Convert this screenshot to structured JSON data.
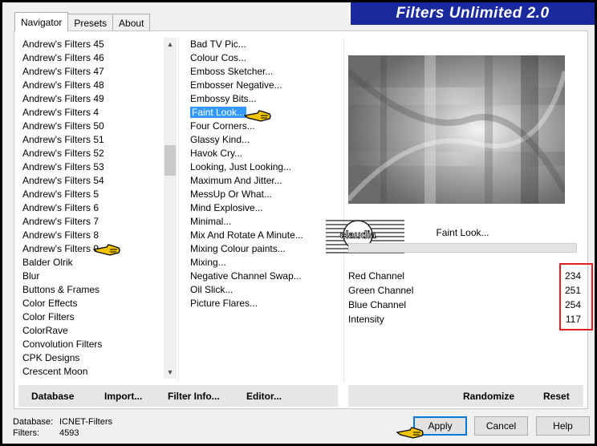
{
  "banner_title": "Filters Unlimited 2.0",
  "tabs": [
    {
      "label": "Navigator",
      "active": true
    },
    {
      "label": "Presets",
      "active": false
    },
    {
      "label": "About",
      "active": false
    }
  ],
  "categories": [
    "Andrew's Filters 45",
    "Andrew's Filters 46",
    "Andrew's Filters 47",
    "Andrew's Filters 48",
    "Andrew's Filters 49",
    "Andrew's Filters 4",
    "Andrew's Filters 50",
    "Andrew's Filters 51",
    "Andrew's Filters 52",
    "Andrew's Filters 53",
    "Andrew's Filters 54",
    "Andrew's Filters 5",
    "Andrew's Filters 6",
    "Andrew's Filters 7",
    "Andrew's Filters 8",
    "Andrew's Filters 9",
    "Balder Olrik",
    "Blur",
    "Buttons & Frames",
    "Color Effects",
    "Color Filters",
    "ColorRave",
    "Convolution Filters",
    "CPK Designs",
    "Crescent Moon"
  ],
  "selected_category": "Andrew's Filters 9",
  "filters": [
    "Bad TV Pic...",
    "Colour Cos...",
    "Emboss Sketcher...",
    "Embosser Negative...",
    "Embossy Bits...",
    "Faint Look...",
    "Four Corners...",
    "Glassy Kind...",
    "Havok Cry...",
    "Looking, Just Looking...",
    "Maximum And Jitter...",
    "MessUp Or What...",
    "Mind Explosive...",
    "Minimal...",
    "Mix And Rotate A Minute...",
    "Mixing Colour paints...",
    "Mixing...",
    "Negative Channel Swap...",
    "Oil Slick...",
    "Picture Flares..."
  ],
  "selected_filter": "Faint Look...",
  "preview_label": "Faint Look...",
  "logo_text": "claudia",
  "params": [
    {
      "name": "Red Channel",
      "value": "234"
    },
    {
      "name": "Green Channel",
      "value": "251"
    },
    {
      "name": "Blue Channel",
      "value": "254"
    },
    {
      "name": "Intensity",
      "value": "117"
    }
  ],
  "left_buttons": {
    "database": "Database",
    "import": "Import...",
    "filter_info": "Filter Info...",
    "editor": "Editor..."
  },
  "right_buttons": {
    "randomize": "Randomize",
    "reset": "Reset"
  },
  "status": {
    "database_label": "Database:",
    "database_value": "ICNET-Filters",
    "filters_label": "Filters:",
    "filters_value": "4593"
  },
  "dialog_buttons": {
    "apply": "Apply",
    "cancel": "Cancel",
    "help": "Help"
  },
  "colors": {
    "banner": "#1a2a9e",
    "selection": "#3399ff",
    "highlight_box": "#e02020",
    "hand": "#f2c400"
  }
}
